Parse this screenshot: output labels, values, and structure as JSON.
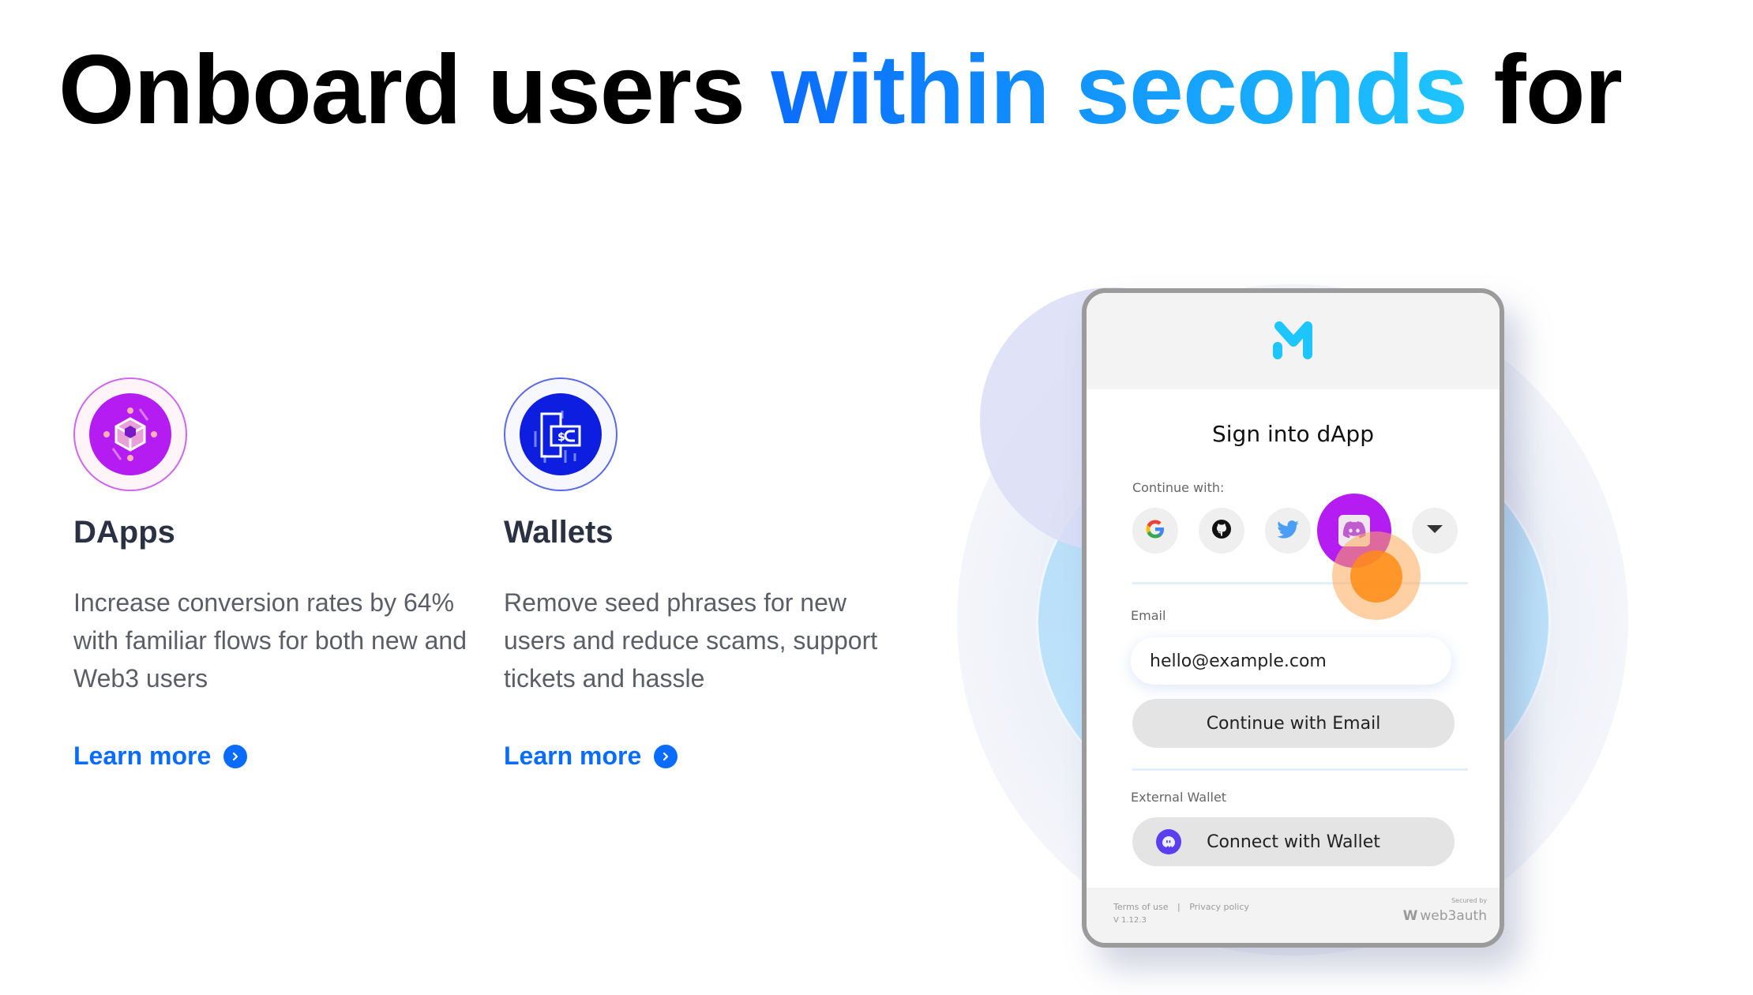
{
  "hero": {
    "title_part1": "Onboard users ",
    "title_accent": "within seconds",
    "title_part2": " for",
    "accent_gradient": [
      "#0a6cff",
      "#1ec6ff"
    ]
  },
  "features": [
    {
      "icon": "cube-icon",
      "title": "DApps",
      "body": "Increase conversion rates by 64% with familiar flows for both new and Web3 users",
      "link": "Learn more"
    },
    {
      "icon": "wallet-icon",
      "title": "Wallets",
      "body": "Remove seed phrases for new users and reduce scams, support tickets and hassle",
      "link": "Learn more"
    }
  ],
  "login_modal": {
    "logo": "m-logo-icon",
    "title": "Sign into dApp",
    "continue_label": "Continue with:",
    "social_providers": [
      "google",
      "github",
      "twitter",
      "discord",
      "more"
    ],
    "email_label": "Email",
    "email_value": "hello@example.com",
    "continue_email_button": "Continue with Email",
    "external_wallet_label": "External Wallet",
    "connect_wallet_button": "Connect with Wallet",
    "footer": {
      "terms": "Terms of use",
      "separator": "|",
      "privacy": "Privacy policy",
      "version": "V 1.12.3",
      "secured_by": "Secured by",
      "brand": "web3auth"
    }
  },
  "colors": {
    "link_blue": "#0a6cff",
    "logo_cyan": "#1ec6ff",
    "discord_purple": "#b41cf2",
    "tap_orange": "#ff8c14"
  }
}
